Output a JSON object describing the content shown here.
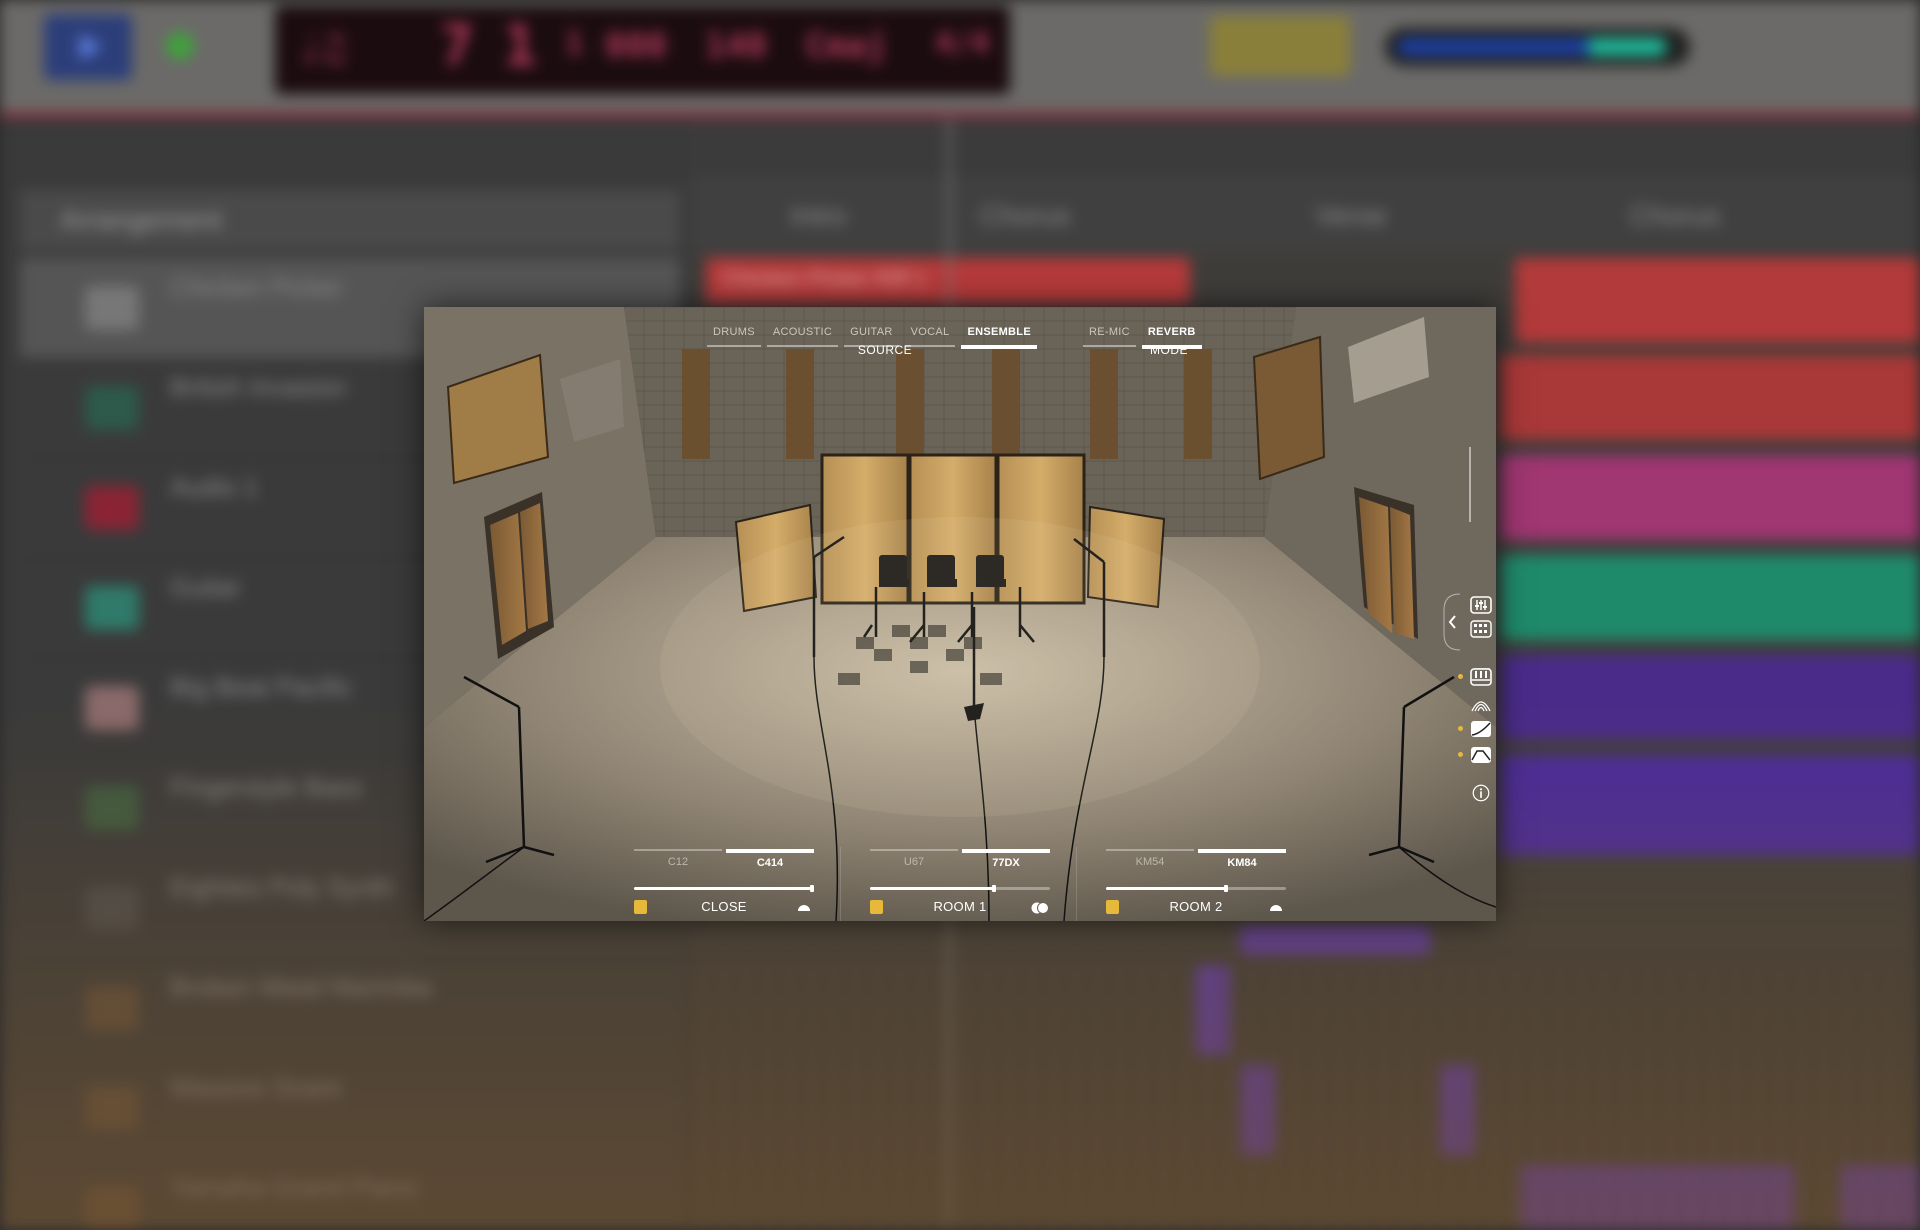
{
  "plugin": {
    "source_tabs": [
      {
        "label": "DRUMS",
        "active": false
      },
      {
        "label": "ACOUSTIC",
        "active": false
      },
      {
        "label": "GUITAR",
        "active": false
      },
      {
        "label": "VOCAL",
        "active": false
      },
      {
        "label": "ENSEMBLE",
        "active": true
      }
    ],
    "source_label": "SOURCE",
    "mode_tabs": [
      {
        "label": "RE-MIC",
        "active": false
      },
      {
        "label": "REVERB",
        "active": true
      }
    ],
    "mode_label": "MODE",
    "mics": [
      {
        "label": "CLOSE",
        "options": [
          "C12",
          "C414"
        ],
        "selected": "C414",
        "level": 1.0,
        "enabled": true,
        "pan_icon": "single-circle-icon"
      },
      {
        "label": "ROOM 1",
        "options": [
          "U67",
          "77DX"
        ],
        "selected": "77DX",
        "level": 0.7,
        "enabled": true,
        "pan_icon": "double-circle-icon"
      },
      {
        "label": "ROOM 2",
        "options": [
          "KM54",
          "KM84"
        ],
        "selected": "KM84",
        "level": 0.67,
        "enabled": true,
        "pan_icon": "single-circle-icon"
      }
    ],
    "side_icons": [
      "chevron-left-icon",
      "mixer-icon",
      "grid-icon",
      "piano-icon",
      "room-icon",
      "eq-curve-icon",
      "envelope-icon",
      "info-icon"
    ],
    "accent_color": "#e6b93a"
  }
}
